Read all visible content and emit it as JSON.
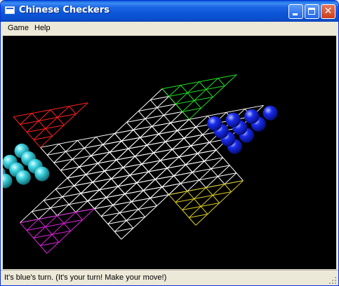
{
  "window": {
    "title": "Chinese Checkers"
  },
  "titlebar_buttons": [
    "minimize-button",
    "maximize-button",
    "close-button"
  ],
  "menu": {
    "items": [
      "Game",
      "Help"
    ]
  },
  "board": {
    "colors": {
      "background": "#000000",
      "grid": "#ffffff",
      "top_triangle": "#ff2020",
      "upper_right_triangle": "#20e020",
      "left_triangle": "#e020e0",
      "bottom_triangle": "#e0d020",
      "cyan_marbles": "#22c8d6",
      "blue_marbles": "#1020e8"
    },
    "cyan_marble_count": 10,
    "blue_marble_count": 10
  },
  "status": {
    "text": "It's blue's turn.  (It's your turn!  Make your move!)"
  }
}
